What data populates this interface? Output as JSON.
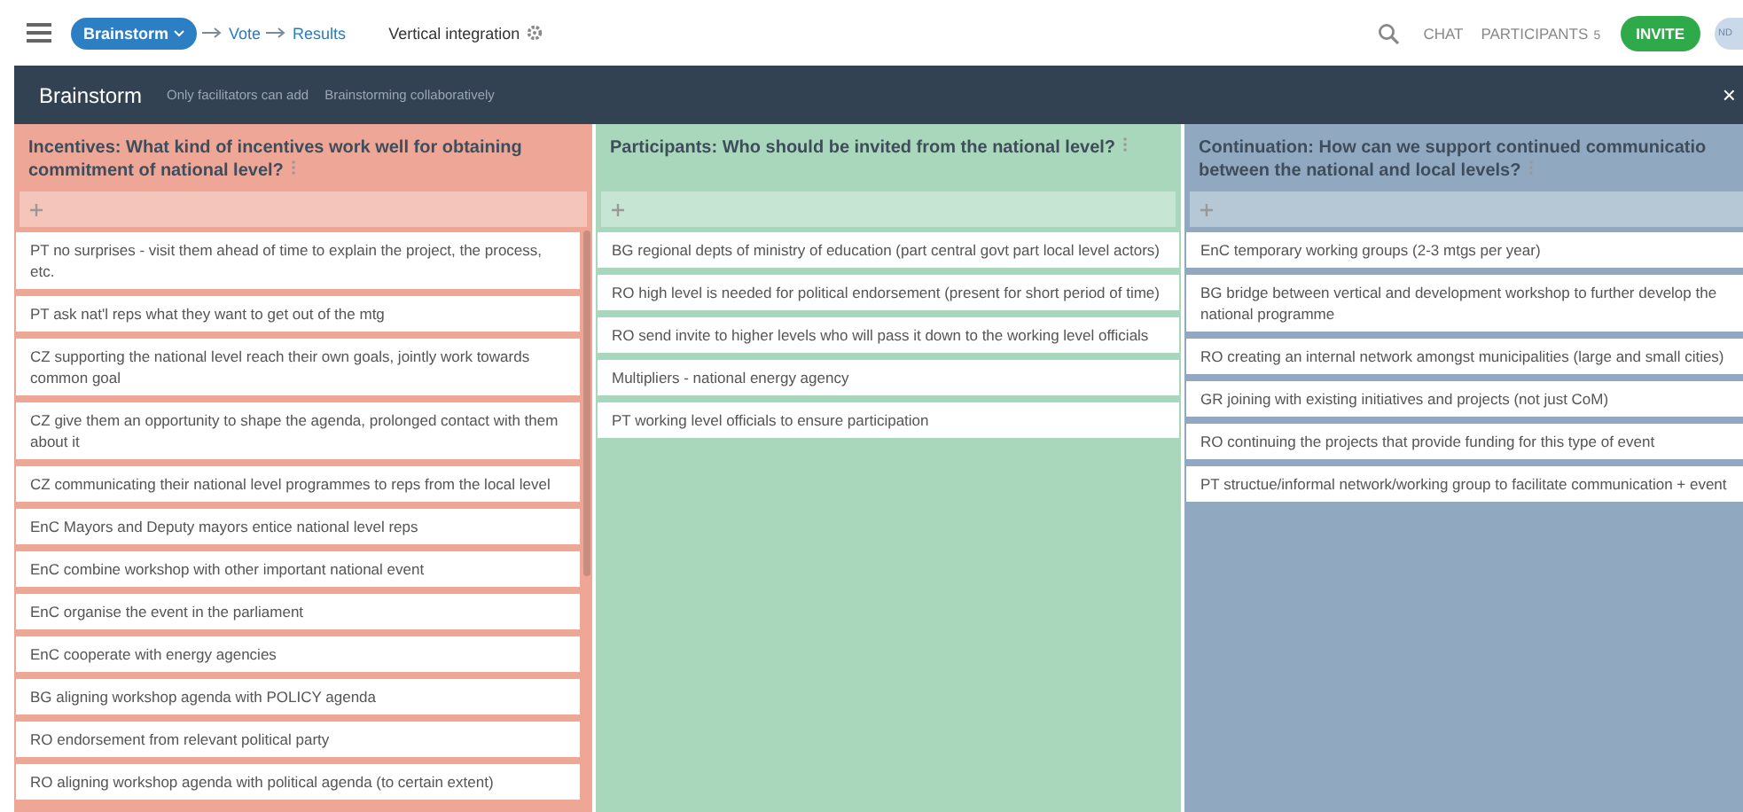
{
  "topbar": {
    "steps": [
      {
        "label": "Brainstorm",
        "selected": true
      },
      {
        "label": "Vote",
        "selected": false
      },
      {
        "label": "Results",
        "selected": false
      }
    ],
    "session_title": "Vertical integration",
    "chat": "CHAT",
    "participants": {
      "label": "PARTICIPANTS",
      "count": "5"
    },
    "invite": "INVITE",
    "avatar": "ND"
  },
  "subbar": {
    "title": "Brainstorm",
    "notes": [
      "Only facilitators can add",
      "Brainstorming collaboratively"
    ],
    "close": "×"
  },
  "columns": [
    {
      "title_lines": [
        "Incentives: What kind of incentives work well for obtaining commitment of national level?"
      ],
      "color": "#eea797",
      "scrollbar": true,
      "cards": [
        "PT no surprises - visit them ahead of time to explain the project, the process, etc.",
        "PT ask nat'l reps what they want to get out of the mtg",
        "CZ supporting the national level reach their own goals, jointly work towards common goal",
        "CZ give them an opportunity to shape the agenda, prolonged contact with them about it",
        "CZ communicating their national level programmes to reps from the local level",
        "EnC Mayors and Deputy mayors entice national level reps",
        "EnC combine workshop with other important national event",
        "EnC organise the event in the parliament",
        "EnC cooperate with energy agencies",
        "BG aligning workshop agenda with POLICY agenda",
        "RO endorsement from relevant political party",
        "RO aligning workshop agenda with political agenda (to certain extent)"
      ]
    },
    {
      "title_lines": [
        "Participants: Who should be invited from the national level?"
      ],
      "color": "#a8d7bb",
      "scrollbar": false,
      "cards": [
        "BG regional depts of ministry of education (part central govt part local level actors)",
        "RO high level is needed for political endorsement (present for short period of time)",
        "RO send invite to higher levels who will pass it down to the working level officials",
        "Multipliers - national energy agency",
        "PT working level officials to ensure participation"
      ]
    },
    {
      "title_lines": [
        "Continuation: How can we support continued communicatio",
        "between the national and local levels?"
      ],
      "color": "#90a9c1",
      "scrollbar": false,
      "cards": [
        "EnC temporary working groups (2-3 mtgs per year)",
        "BG bridge between vertical and development workshop to further develop the national programme",
        "RO creating an internal network amongst municipalities (large and small cities)",
        "GR joining with existing initiatives and projects (not just CoM)",
        "RO continuing the projects that provide funding for this type of event",
        "PT structue/informal network/working group to facilitate communication + event"
      ]
    }
  ]
}
